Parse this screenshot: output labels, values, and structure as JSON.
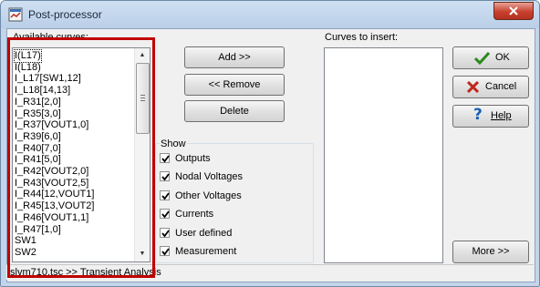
{
  "window": {
    "title": "Post-processor"
  },
  "available": {
    "label": "Available curves:",
    "items": [
      "I(L17)",
      "I(L18)",
      "I_L17[SW1,12]",
      "I_L18[14,13]",
      "I_R31[2,0]",
      "I_R35[3,0]",
      "I_R37[VOUT1,0]",
      "I_R39[6,0]",
      "I_R40[7,0]",
      "I_R41[5,0]",
      "I_R42[VOUT2,0]",
      "I_R43[VOUT2,5]",
      "I_R44[12,VOUT1]",
      "I_R45[13,VOUT2]",
      "I_R46[VOUT1,1]",
      "I_R47[1,0]",
      "SW1",
      "SW2"
    ],
    "selected_index": 0
  },
  "buttons": {
    "add": "Add >>",
    "remove": "<< Remove",
    "delete": "Delete",
    "ok": "OK",
    "cancel": "Cancel",
    "help": "Help",
    "more": "More >>"
  },
  "show": {
    "label": "Show",
    "options": [
      {
        "label": "Outputs",
        "checked": true
      },
      {
        "label": "Nodal Voltages",
        "checked": true
      },
      {
        "label": "Other Voltages",
        "checked": true
      },
      {
        "label": "Currents",
        "checked": true
      },
      {
        "label": "User defined",
        "checked": true
      },
      {
        "label": "Measurement",
        "checked": true
      }
    ]
  },
  "insert": {
    "label": "Curves to insert:"
  },
  "status": {
    "text": "slvm710.tsc >> Transient Analysis"
  },
  "colors": {
    "highlight": "#c00000",
    "ok_check": "#2a8a1a",
    "cancel_x": "#c0281c",
    "help_q": "#1a5fb4"
  }
}
